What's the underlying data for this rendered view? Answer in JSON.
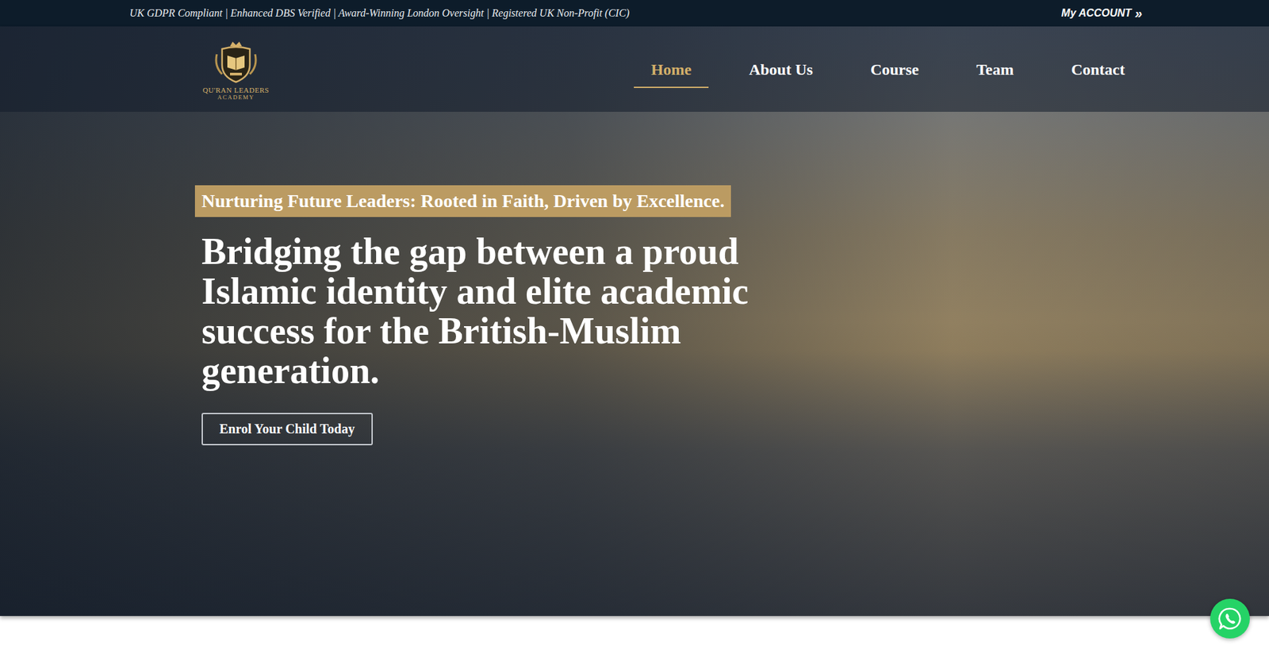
{
  "top_bar": {
    "text": "UK GDPR Compliant | Enhanced DBS Verified | Award-Winning London Oversight | Registered UK Non-Profit (CIC)",
    "account": {
      "label": "My ACCOUNT",
      "icon": "»"
    }
  },
  "logo": {
    "name": "QU'RAN LEADERS",
    "subtitle": "ACADEMY"
  },
  "nav": [
    {
      "label": "Home",
      "selected": true
    },
    {
      "label": "About Us",
      "selected": false
    },
    {
      "label": "Course",
      "selected": false
    },
    {
      "label": "Team",
      "selected": false
    },
    {
      "label": "Contact",
      "selected": false
    }
  ],
  "hero": {
    "tagline": "Nurturing Future Leaders: Rooted in Faith, Driven by Excellence.",
    "heading": "Bridging the gap between a proud Islamic identity and elite academic success for the British-Muslim generation.",
    "button": "Enrol Your Child Today"
  }
}
